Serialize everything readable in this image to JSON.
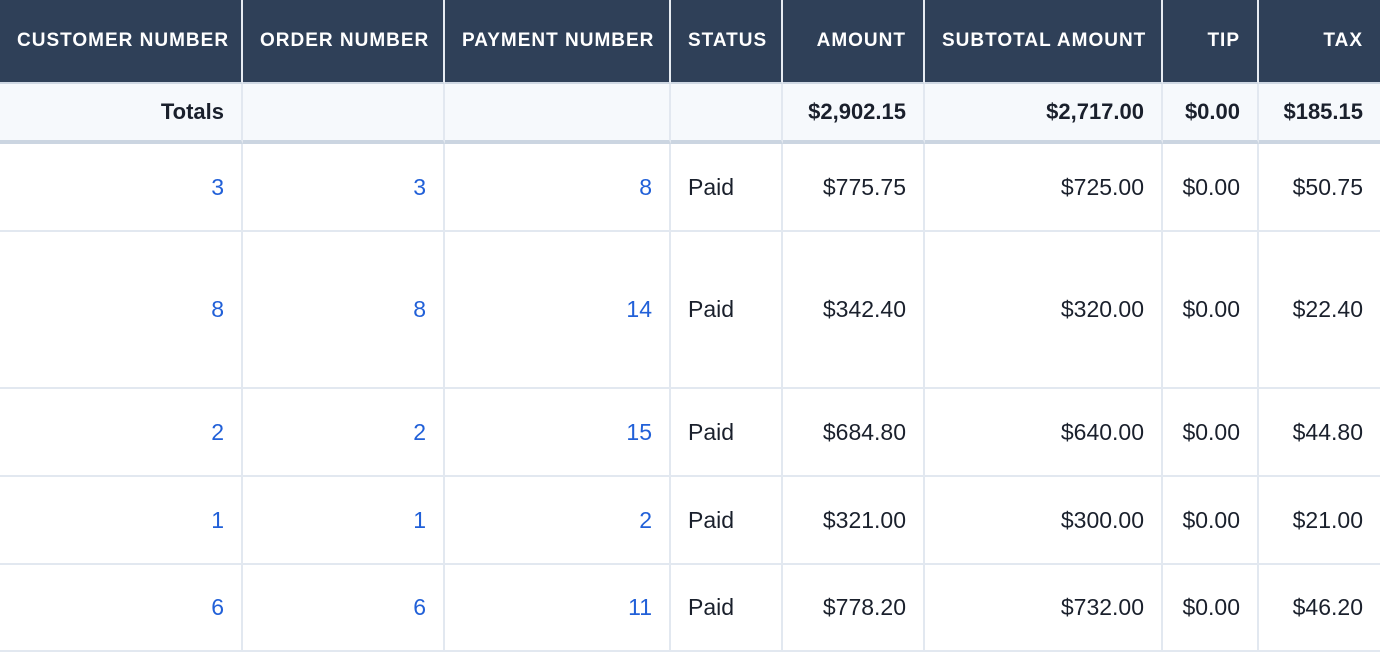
{
  "headers": [
    "CUSTOMER NUMBER",
    "ORDER NUMBER",
    "PAYMENT NUMBER",
    "STATUS",
    "AMOUNT",
    "SUBTOTAL AMOUNT",
    "TIP",
    "TAX"
  ],
  "totals": {
    "label": "Totals",
    "amount": "$2,902.15",
    "subtotal": "$2,717.00",
    "tip": "$0.00",
    "tax": "$185.15"
  },
  "rows": [
    {
      "customer": "3",
      "order": "3",
      "payment": "8",
      "status": "Paid",
      "amount": "$775.75",
      "subtotal": "$725.00",
      "tip": "$0.00",
      "tax": "$50.75"
    },
    {
      "customer": "8",
      "order": "8",
      "payment": "14",
      "status": "Paid",
      "amount": "$342.40",
      "subtotal": "$320.00",
      "tip": "$0.00",
      "tax": "$22.40"
    },
    {
      "customer": "2",
      "order": "2",
      "payment": "15",
      "status": "Paid",
      "amount": "$684.80",
      "subtotal": "$640.00",
      "tip": "$0.00",
      "tax": "$44.80"
    },
    {
      "customer": "1",
      "order": "1",
      "payment": "2",
      "status": "Paid",
      "amount": "$321.00",
      "subtotal": "$300.00",
      "tip": "$0.00",
      "tax": "$21.00"
    },
    {
      "customer": "6",
      "order": "6",
      "payment": "11",
      "status": "Paid",
      "amount": "$778.20",
      "subtotal": "$732.00",
      "tip": "$0.00",
      "tax": "$46.20"
    }
  ],
  "colors": {
    "header_bg": "#2f4058",
    "link": "#2160d8",
    "totals_bg": "#f6f9fc",
    "border": "#e2e8f0"
  }
}
